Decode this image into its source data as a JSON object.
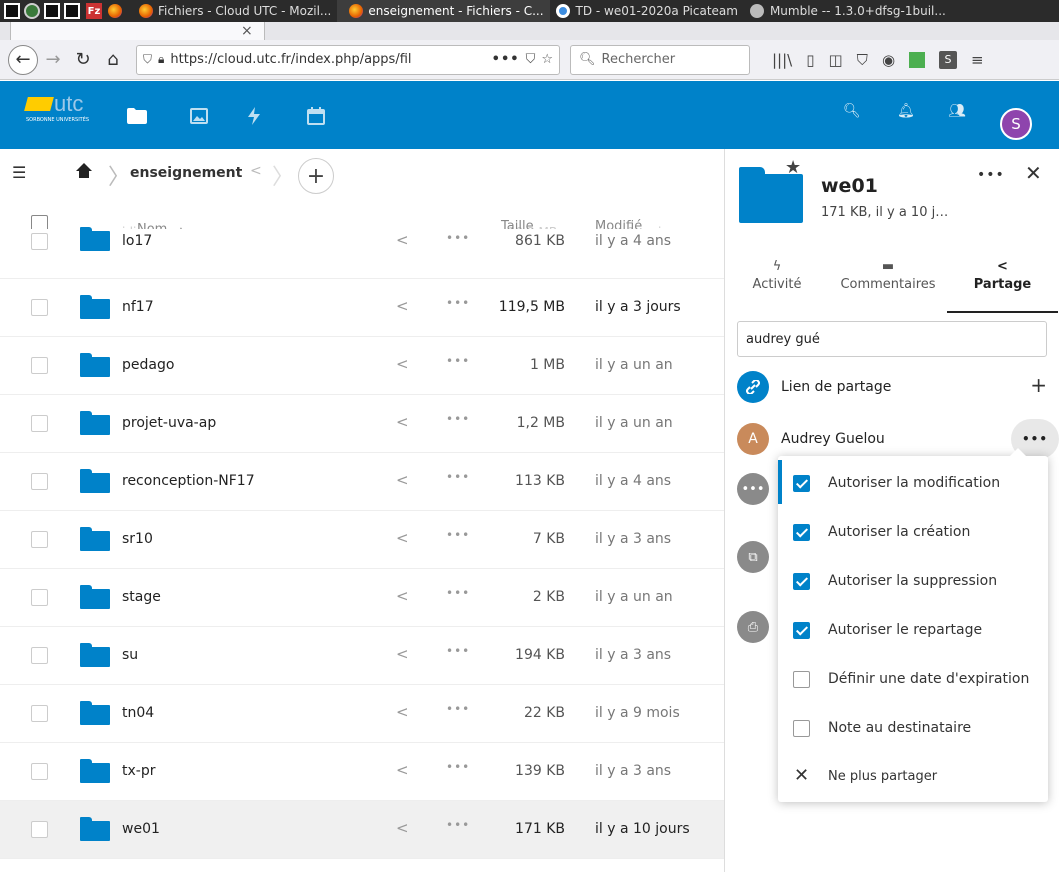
{
  "taskbar": {
    "tasks": [
      {
        "label": "Fichiers - Cloud UTC - Mozil...",
        "active": false
      },
      {
        "label": "enseignement - Fichiers - C...",
        "active": true
      },
      {
        "label": "TD - we01-2020a Picateam",
        "active": false
      },
      {
        "label": "Mumble -- 1.3.0+dfsg-1buil...",
        "active": false
      }
    ],
    "tab_fragment": "s"
  },
  "browser": {
    "url": "https://cloud.utc.fr/index.php/apps/fil",
    "search_placeholder": "Rechercher"
  },
  "header": {
    "logo_text": "utc",
    "logo_sub": "SORBONNE UNIVERSITÉS",
    "avatar_letter": "S",
    "accent_color": "#0082c9"
  },
  "breadcrumb": {
    "current": "enseignement"
  },
  "list": {
    "ghost_row": {
      "name": "idi",
      "size": "10,3 MB",
      "modified": "il y a 1 mois"
    },
    "header": {
      "name": "Nom",
      "size": "Taille",
      "modified": "Modifié"
    },
    "partial_row": {
      "name": "lo17",
      "size": "861 KB",
      "modified": "il y a 4 ans"
    },
    "rows": [
      {
        "name": "nf17",
        "size": "119,5 MB",
        "modified": "il y a 3 jours"
      },
      {
        "name": "pedago",
        "size": "1 MB",
        "modified": "il y a un an"
      },
      {
        "name": "projet-uva-ap",
        "size": "1,2 MB",
        "modified": "il y a un an"
      },
      {
        "name": "reconception-NF17",
        "size": "113 KB",
        "modified": "il y a 4 ans"
      },
      {
        "name": "sr10",
        "size": "7 KB",
        "modified": "il y a 3 ans"
      },
      {
        "name": "stage",
        "size": "2 KB",
        "modified": "il y a un an"
      },
      {
        "name": "su",
        "size": "194 KB",
        "modified": "il y a 3 ans"
      },
      {
        "name": "tn04",
        "size": "22 KB",
        "modified": "il y a 9 mois"
      },
      {
        "name": "tx-pr",
        "size": "139 KB",
        "modified": "il y a 3 ans"
      },
      {
        "name": "we01",
        "size": "171 KB",
        "modified": "il y a 10 jours"
      }
    ]
  },
  "sidebar": {
    "title": "we01",
    "subtitle": "171 KB, il y a 10 j…",
    "tabs": [
      {
        "label": "Activité"
      },
      {
        "label": "Commentaires"
      },
      {
        "label": "Partage"
      }
    ],
    "search_value": "audrey gué",
    "share_link_label": "Lien de partage",
    "share_user": {
      "initial": "A",
      "name": "Audrey Guelou",
      "color": "#c98a5b"
    }
  },
  "popover": {
    "items": [
      {
        "label": "Autoriser la modification",
        "checked": true
      },
      {
        "label": "Autoriser la création",
        "checked": true
      },
      {
        "label": "Autoriser la suppression",
        "checked": true
      },
      {
        "label": "Autoriser le repartage",
        "checked": true
      },
      {
        "label": "Définir une date d'expiration",
        "checked": false
      },
      {
        "label": "Note au destinataire",
        "checked": false
      }
    ],
    "unshare_label": "Ne plus partager"
  }
}
